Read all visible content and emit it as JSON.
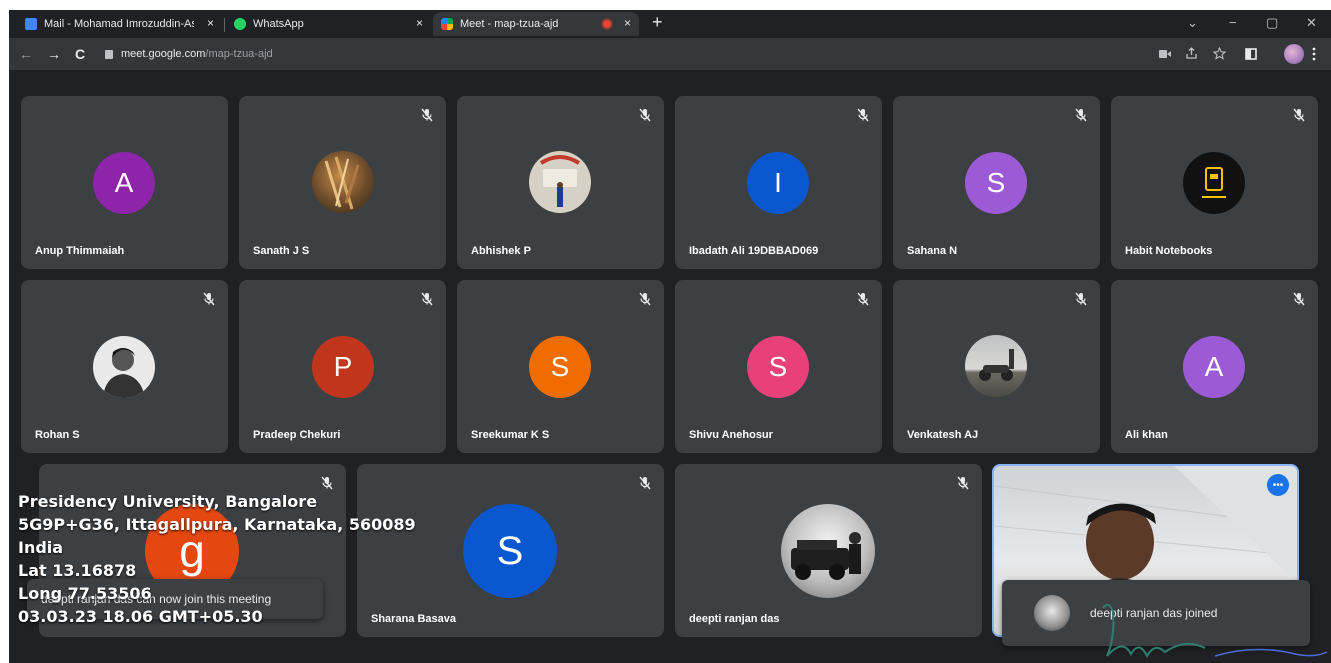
{
  "browser": {
    "tabs": [
      {
        "title": "Mail - Mohamad Imrozuddin-As",
        "close": "×",
        "favicon_color": "#4285f4",
        "active": false
      },
      {
        "title": "WhatsApp",
        "close": "×",
        "favicon_color": "#25d366",
        "active": false
      },
      {
        "title": "Meet - map-tzua-ajd",
        "close": "×",
        "favicon_color": "#00ac47",
        "active": true
      }
    ],
    "new_tab": "+",
    "window_controls": {
      "chevron": "⌄",
      "minimize": "−",
      "restore": "▢",
      "close": "✕"
    },
    "nav": {
      "back": "←",
      "forward": "→",
      "reload": "C"
    },
    "url_host": "meet.google.com",
    "url_path": "/map-tzua-ajd",
    "toolbar_icons": [
      "camera-icon",
      "share-icon",
      "star-icon",
      "sidepanel-icon",
      "profile-icon",
      "menu-icon"
    ]
  },
  "participants": [
    {
      "name": "Anup Thimmaiah",
      "initial": "A",
      "color": "#8e24aa",
      "muted": false
    },
    {
      "name": "Sanath J S",
      "initial": "",
      "color": "#7a5a3a",
      "muted": true,
      "photo": true
    },
    {
      "name": "Abhishek P",
      "initial": "",
      "color": "#cfc9bd",
      "muted": true,
      "photo": true
    },
    {
      "name": "Ibadath Ali 19DBBAD069",
      "initial": "I",
      "color": "#0b57d0",
      "muted": true
    },
    {
      "name": "Sahana N",
      "initial": "S",
      "color": "#9c5ad6",
      "muted": true
    },
    {
      "name": "Habit Notebooks",
      "initial": "",
      "color": "#111111",
      "muted": true,
      "photo": true
    },
    {
      "name": "Rohan S",
      "initial": "",
      "color": "#d9d9d9",
      "muted": true,
      "photo": true
    },
    {
      "name": "Pradeep Chekuri",
      "initial": "P",
      "color": "#c1351d",
      "muted": true
    },
    {
      "name": "Sreekumar K S",
      "initial": "S",
      "color": "#ef6c00",
      "muted": true
    },
    {
      "name": "Shivu Anehosur",
      "initial": "S",
      "color": "#e8417a",
      "muted": true
    },
    {
      "name": "Venkatesh AJ",
      "initial": "",
      "color": "#8a8a86",
      "muted": true,
      "photo": true
    },
    {
      "name": "Ali khan",
      "initial": "A",
      "color": "#9c5ad6",
      "muted": true
    },
    {
      "name": "",
      "initial": "g",
      "color": "#e4470f",
      "muted": true
    },
    {
      "name": "Sharana Basava",
      "initial": "S",
      "color": "#0b57d0",
      "muted": true
    },
    {
      "name": "deepti ranjan das",
      "initial": "",
      "color": "#cfcfcf",
      "muted": true,
      "photo": true
    }
  ],
  "self_view": {
    "more_label": "•••"
  },
  "toasts": {
    "can_join": "deepti ranjan das can now join this meeting",
    "joined": "deepti ranjan das joined"
  },
  "geotag": {
    "line1": "Presidency University, Bangalore",
    "line2": "5G9P+G36, Ittagallpura, Karnataka, 560089",
    "line3": "India",
    "line4": "Lat 13.16878",
    "line5": "Long 77.53506",
    "line6": "03.03.23  18.06 GMT+05.30"
  }
}
